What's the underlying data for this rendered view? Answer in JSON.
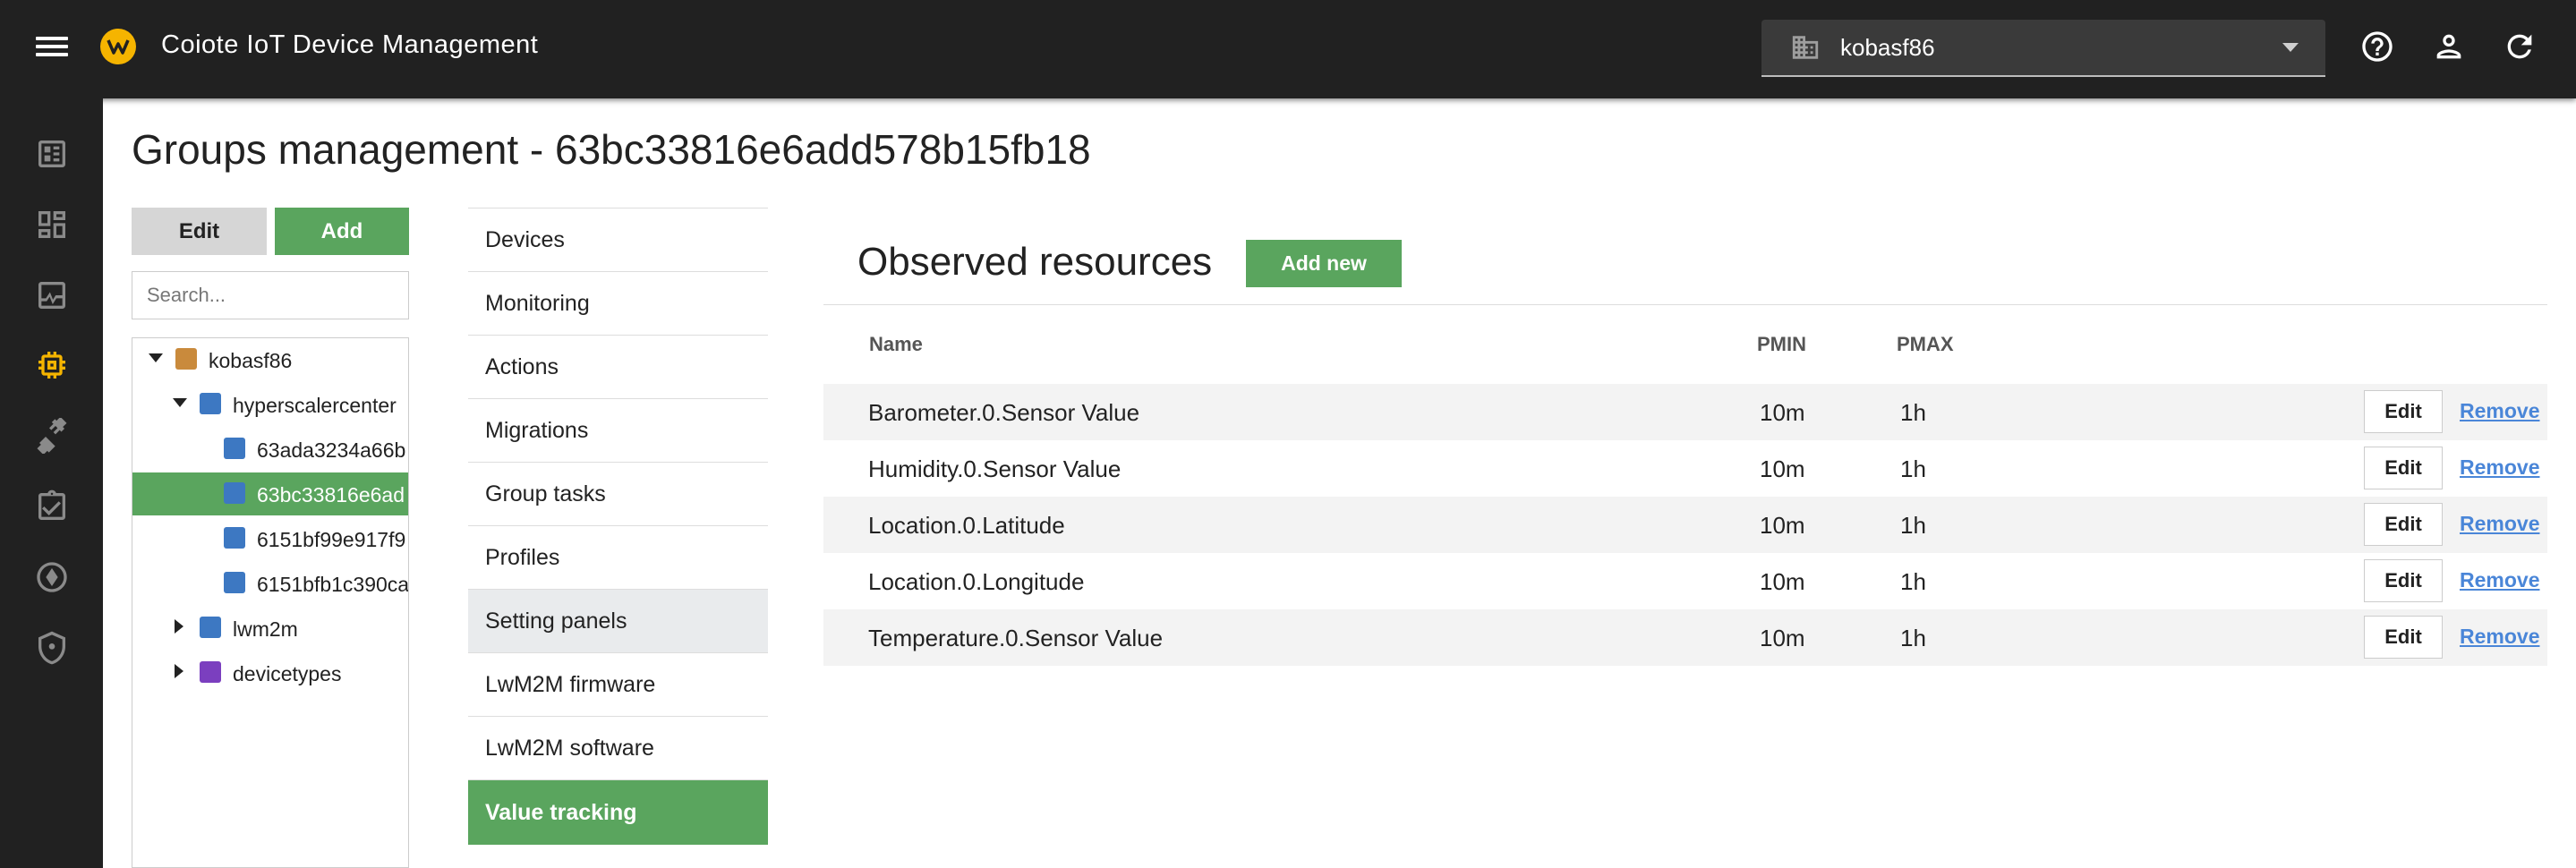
{
  "app": {
    "title": "Coiote IoT Device Management"
  },
  "tenant": {
    "name": "kobasf86"
  },
  "icons": {
    "menu": "hamburger-icon",
    "logo": "coiote-logo",
    "tenant": "building-icon",
    "help": "help-icon",
    "account": "account-icon",
    "refresh": "refresh-icon",
    "rail": [
      "dashboard-icon",
      "widgets-icon",
      "monitoring-icon",
      "device-chip-icon",
      "connector-icon",
      "tasks-icon",
      "lens-icon",
      "security-icon"
    ]
  },
  "colors": {
    "accent": "#5aa55e",
    "link": "#4a86d8",
    "topbar": "#212121",
    "rail_active": "#f5b400"
  },
  "page": {
    "title": "Groups management - 63bc33816e6add578b15fb18"
  },
  "left": {
    "edit_label": "Edit",
    "add_label": "Add",
    "search_placeholder": "Search..."
  },
  "tree": {
    "nodes": [
      {
        "label": "kobasf86",
        "expanded": true,
        "selected": false
      },
      {
        "label": "hyperscalercenter",
        "expanded": true,
        "selected": false
      },
      {
        "label": "63ada3234a66b",
        "selected": false
      },
      {
        "label": "63bc33816e6ad",
        "selected": true
      },
      {
        "label": "6151bf99e917f9",
        "selected": false
      },
      {
        "label": "6151bfb1c390ca",
        "selected": false
      },
      {
        "label": "lwm2m",
        "expanded": false,
        "selected": false
      },
      {
        "label": "devicetypes",
        "expanded": false,
        "selected": false
      }
    ]
  },
  "menu": {
    "items": [
      {
        "label": "Devices"
      },
      {
        "label": "Monitoring"
      },
      {
        "label": "Actions"
      },
      {
        "label": "Migrations"
      },
      {
        "label": "Group tasks"
      },
      {
        "label": "Profiles"
      },
      {
        "label": "Setting panels"
      },
      {
        "label": "LwM2M firmware"
      },
      {
        "label": "LwM2M software"
      },
      {
        "label": "Value tracking",
        "active": true
      }
    ]
  },
  "observed": {
    "title": "Observed resources",
    "add_new_label": "Add new",
    "columns": {
      "name": "Name",
      "pmin": "PMIN",
      "pmax": "PMAX"
    },
    "rows": [
      {
        "name": "Barometer.0.Sensor Value",
        "pmin": "10m",
        "pmax": "1h",
        "edit": "Edit",
        "remove": "Remove"
      },
      {
        "name": "Humidity.0.Sensor Value",
        "pmin": "10m",
        "pmax": "1h",
        "edit": "Edit",
        "remove": "Remove"
      },
      {
        "name": "Location.0.Latitude",
        "pmin": "10m",
        "pmax": "1h",
        "edit": "Edit",
        "remove": "Remove"
      },
      {
        "name": "Location.0.Longitude",
        "pmin": "10m",
        "pmax": "1h",
        "edit": "Edit",
        "remove": "Remove"
      },
      {
        "name": "Temperature.0.Sensor Value",
        "pmin": "10m",
        "pmax": "1h",
        "edit": "Edit",
        "remove": "Remove"
      }
    ]
  }
}
